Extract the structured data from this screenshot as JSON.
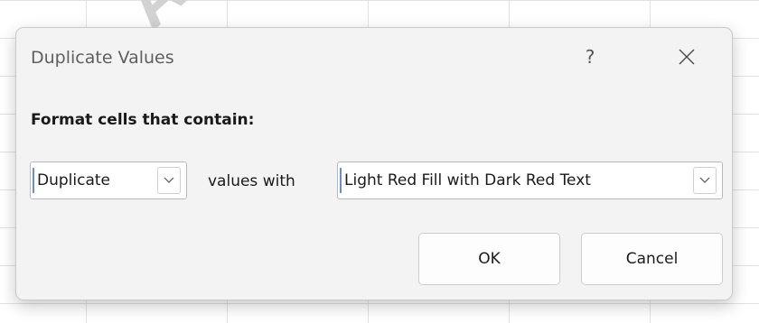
{
  "dialog": {
    "title": "Duplicate Values",
    "help_label": "?",
    "section_label": "Format cells that contain:",
    "type_select": {
      "value": "Duplicate"
    },
    "values_with_label": "values with",
    "format_select": {
      "value": "Light Red Fill with Dark Red Text"
    },
    "ok_label": "OK",
    "cancel_label": "Cancel"
  },
  "icons": {
    "close": "close-icon",
    "dropdown": "chevron-down-icon"
  },
  "background": {
    "watermark": "AR"
  }
}
